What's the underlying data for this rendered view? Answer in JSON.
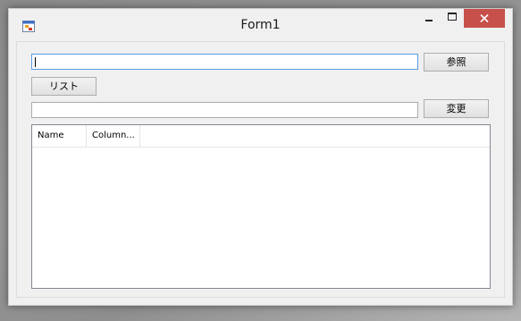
{
  "window": {
    "title": "Form1"
  },
  "form": {
    "path_input_value": "",
    "browse_button_label": "参照",
    "list_button_label": "リスト",
    "rename_input_value": "",
    "change_button_label": "変更"
  },
  "listview": {
    "columns": [
      "Name",
      "Column..."
    ],
    "rows": []
  },
  "colors": {
    "window_bg": "#f0f0f0",
    "close_button": "#c7504a",
    "focus_border": "#569de5"
  }
}
